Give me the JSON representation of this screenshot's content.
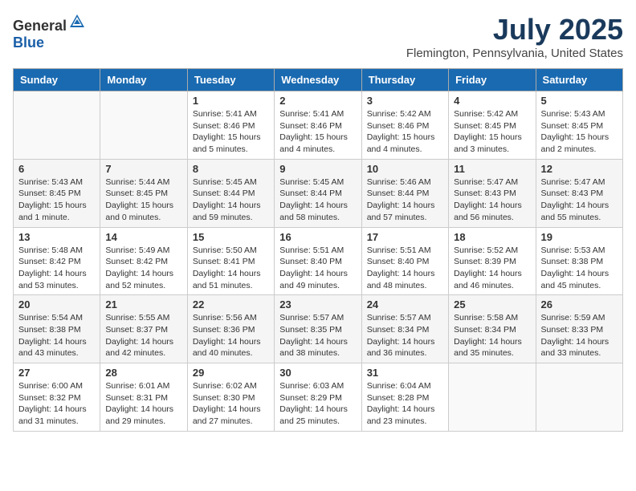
{
  "header": {
    "logo": {
      "text_general": "General",
      "text_blue": "Blue"
    },
    "title": "July 2025",
    "location": "Flemington, Pennsylvania, United States"
  },
  "weekdays": [
    "Sunday",
    "Monday",
    "Tuesday",
    "Wednesday",
    "Thursday",
    "Friday",
    "Saturday"
  ],
  "weeks": [
    [
      {
        "day": "",
        "info": ""
      },
      {
        "day": "",
        "info": ""
      },
      {
        "day": "1",
        "info": "Sunrise: 5:41 AM\nSunset: 8:46 PM\nDaylight: 15 hours\nand 5 minutes."
      },
      {
        "day": "2",
        "info": "Sunrise: 5:41 AM\nSunset: 8:46 PM\nDaylight: 15 hours\nand 4 minutes."
      },
      {
        "day": "3",
        "info": "Sunrise: 5:42 AM\nSunset: 8:46 PM\nDaylight: 15 hours\nand 4 minutes."
      },
      {
        "day": "4",
        "info": "Sunrise: 5:42 AM\nSunset: 8:45 PM\nDaylight: 15 hours\nand 3 minutes."
      },
      {
        "day": "5",
        "info": "Sunrise: 5:43 AM\nSunset: 8:45 PM\nDaylight: 15 hours\nand 2 minutes."
      }
    ],
    [
      {
        "day": "6",
        "info": "Sunrise: 5:43 AM\nSunset: 8:45 PM\nDaylight: 15 hours\nand 1 minute."
      },
      {
        "day": "7",
        "info": "Sunrise: 5:44 AM\nSunset: 8:45 PM\nDaylight: 15 hours\nand 0 minutes."
      },
      {
        "day": "8",
        "info": "Sunrise: 5:45 AM\nSunset: 8:44 PM\nDaylight: 14 hours\nand 59 minutes."
      },
      {
        "day": "9",
        "info": "Sunrise: 5:45 AM\nSunset: 8:44 PM\nDaylight: 14 hours\nand 58 minutes."
      },
      {
        "day": "10",
        "info": "Sunrise: 5:46 AM\nSunset: 8:44 PM\nDaylight: 14 hours\nand 57 minutes."
      },
      {
        "day": "11",
        "info": "Sunrise: 5:47 AM\nSunset: 8:43 PM\nDaylight: 14 hours\nand 56 minutes."
      },
      {
        "day": "12",
        "info": "Sunrise: 5:47 AM\nSunset: 8:43 PM\nDaylight: 14 hours\nand 55 minutes."
      }
    ],
    [
      {
        "day": "13",
        "info": "Sunrise: 5:48 AM\nSunset: 8:42 PM\nDaylight: 14 hours\nand 53 minutes."
      },
      {
        "day": "14",
        "info": "Sunrise: 5:49 AM\nSunset: 8:42 PM\nDaylight: 14 hours\nand 52 minutes."
      },
      {
        "day": "15",
        "info": "Sunrise: 5:50 AM\nSunset: 8:41 PM\nDaylight: 14 hours\nand 51 minutes."
      },
      {
        "day": "16",
        "info": "Sunrise: 5:51 AM\nSunset: 8:40 PM\nDaylight: 14 hours\nand 49 minutes."
      },
      {
        "day": "17",
        "info": "Sunrise: 5:51 AM\nSunset: 8:40 PM\nDaylight: 14 hours\nand 48 minutes."
      },
      {
        "day": "18",
        "info": "Sunrise: 5:52 AM\nSunset: 8:39 PM\nDaylight: 14 hours\nand 46 minutes."
      },
      {
        "day": "19",
        "info": "Sunrise: 5:53 AM\nSunset: 8:38 PM\nDaylight: 14 hours\nand 45 minutes."
      }
    ],
    [
      {
        "day": "20",
        "info": "Sunrise: 5:54 AM\nSunset: 8:38 PM\nDaylight: 14 hours\nand 43 minutes."
      },
      {
        "day": "21",
        "info": "Sunrise: 5:55 AM\nSunset: 8:37 PM\nDaylight: 14 hours\nand 42 minutes."
      },
      {
        "day": "22",
        "info": "Sunrise: 5:56 AM\nSunset: 8:36 PM\nDaylight: 14 hours\nand 40 minutes."
      },
      {
        "day": "23",
        "info": "Sunrise: 5:57 AM\nSunset: 8:35 PM\nDaylight: 14 hours\nand 38 minutes."
      },
      {
        "day": "24",
        "info": "Sunrise: 5:57 AM\nSunset: 8:34 PM\nDaylight: 14 hours\nand 36 minutes."
      },
      {
        "day": "25",
        "info": "Sunrise: 5:58 AM\nSunset: 8:34 PM\nDaylight: 14 hours\nand 35 minutes."
      },
      {
        "day": "26",
        "info": "Sunrise: 5:59 AM\nSunset: 8:33 PM\nDaylight: 14 hours\nand 33 minutes."
      }
    ],
    [
      {
        "day": "27",
        "info": "Sunrise: 6:00 AM\nSunset: 8:32 PM\nDaylight: 14 hours\nand 31 minutes."
      },
      {
        "day": "28",
        "info": "Sunrise: 6:01 AM\nSunset: 8:31 PM\nDaylight: 14 hours\nand 29 minutes."
      },
      {
        "day": "29",
        "info": "Sunrise: 6:02 AM\nSunset: 8:30 PM\nDaylight: 14 hours\nand 27 minutes."
      },
      {
        "day": "30",
        "info": "Sunrise: 6:03 AM\nSunset: 8:29 PM\nDaylight: 14 hours\nand 25 minutes."
      },
      {
        "day": "31",
        "info": "Sunrise: 6:04 AM\nSunset: 8:28 PM\nDaylight: 14 hours\nand 23 minutes."
      },
      {
        "day": "",
        "info": ""
      },
      {
        "day": "",
        "info": ""
      }
    ]
  ]
}
